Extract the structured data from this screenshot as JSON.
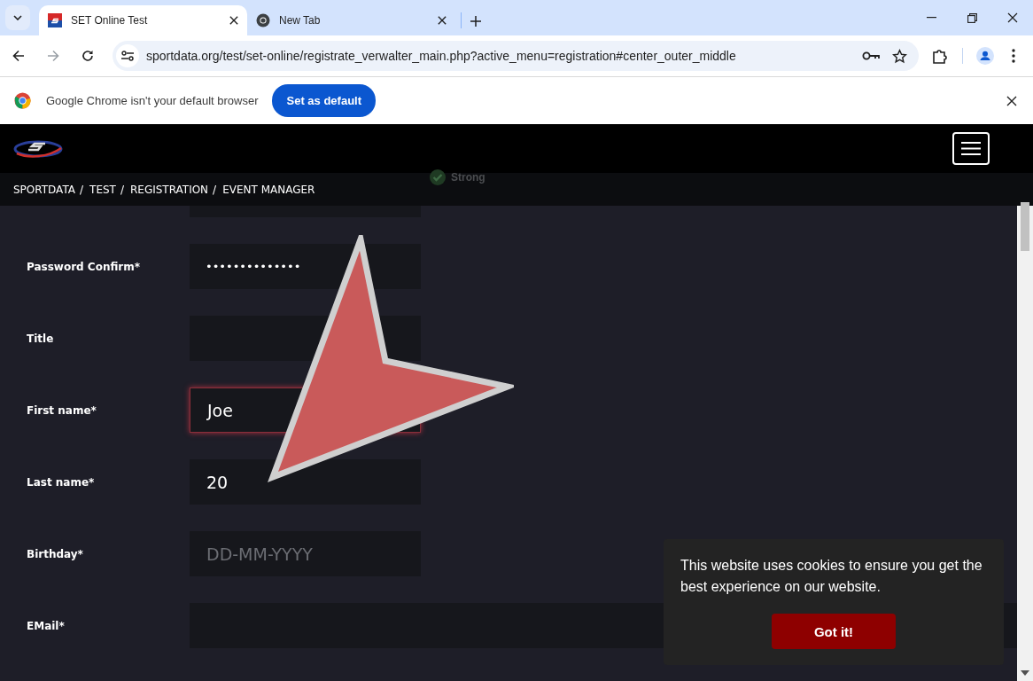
{
  "browser": {
    "tabs": [
      {
        "title": "SET Online Test",
        "selected": true,
        "kind": "site"
      },
      {
        "title": "New Tab",
        "selected": false,
        "kind": "chrome"
      }
    ],
    "address": "sportdata.org/test/set-online/registrate_verwalter_main.php?active_menu=registration#center_outer_middle",
    "infobar": {
      "message": "Google Chrome isn't your default browser",
      "button": "Set as default"
    }
  },
  "site": {
    "breadcrumbs": [
      "SPORTDATA",
      "TEST",
      "REGISTRATION",
      "EVENT MANAGER"
    ],
    "separator": "/",
    "password_strength": "Strong",
    "fields": [
      {
        "label": "Password Confirm*",
        "value": "••••••••••••••",
        "focused": false,
        "kind": "masked"
      },
      {
        "label": "Title",
        "focused": false,
        "kind": "text"
      },
      {
        "label": "First name*",
        "value": "Joe",
        "focused": true,
        "kind": "text"
      },
      {
        "label": "Last name*",
        "value": "20",
        "focused": false,
        "kind": "text"
      },
      {
        "label": "Birthday*",
        "placeholder": "DD-MM-YYYY",
        "focused": false,
        "kind": "text"
      },
      {
        "label": "EMail*",
        "focused": false,
        "kind": "wide"
      }
    ]
  },
  "cookie_banner": {
    "message": "This website uses cookies to ensure you get the best experience on our website.",
    "button": "Got it!"
  }
}
